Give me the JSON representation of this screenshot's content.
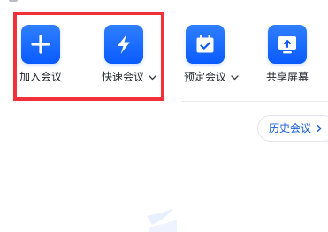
{
  "quick_actions": [
    {
      "label": "加入会议",
      "icon": "plus-icon"
    },
    {
      "label": "快速会议",
      "icon": "lightning-bolt-icon",
      "has_dropdown": true
    },
    {
      "label": "预定会议",
      "icon": "calendar-check-icon",
      "has_dropdown": true
    },
    {
      "label": "共享屏幕",
      "icon": "screen-share-icon"
    }
  ],
  "history": {
    "label": "历史会议",
    "icon": "chevron-right-icon"
  },
  "colors": {
    "tile_blue": "#0a5bff",
    "highlight_red": "#f2303a",
    "history_text": "#1a5fd6"
  }
}
